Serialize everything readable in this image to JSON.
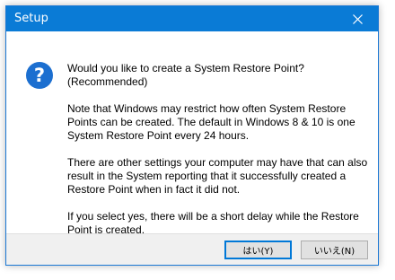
{
  "window": {
    "title": "Setup",
    "close_icon": "close-icon"
  },
  "dialog": {
    "icon": "question-icon",
    "icon_glyph": "?",
    "message": "Would you like to create a System Restore Point? (Recommended)\n\nNote that Windows may restrict how often System Restore Points can be created. The default in Windows 8 & 10 is one System Restore Point every 24 hours.\n\nThere are other settings your computer may have that can also result in the System reporting that it successfully created a Restore Point when in fact it did not.\n\nIf you select yes, there will be a short delay while the Restore Point is created."
  },
  "buttons": {
    "yes_label": "はい(Y)",
    "no_label": "いいえ(N)"
  },
  "colors": {
    "titlebar": "#0a7bd6",
    "icon": "#1c6fd0",
    "default_button_border": "#0078d7"
  }
}
